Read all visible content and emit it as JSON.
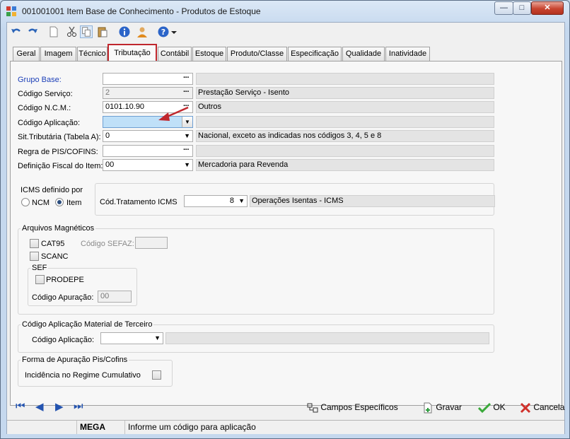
{
  "window": {
    "title": "001001001 Item Base de Conhecimento -  Produtos de Estoque",
    "minimize": "—",
    "maximize": "□",
    "close": "✕"
  },
  "toolbar": {
    "icons": [
      "undo-icon",
      "redo-icon",
      "new-document-icon",
      "cut-icon",
      "copy-icon",
      "paste-icon",
      "info-icon",
      "user-icon",
      "help-icon",
      "dropdown-icon"
    ]
  },
  "tabs": [
    "Geral",
    "Imagem",
    "Técnico",
    "Tributação",
    "Contábil",
    "Estoque",
    "Produto/Classe",
    "Especificação",
    "Qualidade",
    "Inatividade"
  ],
  "selected_tab": "Tributação",
  "fields": {
    "grupo_base": {
      "label": "Grupo Base:",
      "value": "",
      "desc": ""
    },
    "codigo_servico": {
      "label": "Código Serviço:",
      "value": "2",
      "desc": "Prestação Serviço  - Isento"
    },
    "codigo_ncm": {
      "label": "Código N.C.M.:",
      "value": "0101.10.90",
      "desc": "Outros"
    },
    "codigo_aplicacao": {
      "label": "Código Aplicação:",
      "value": "",
      "desc": ""
    },
    "sit_tributaria": {
      "label": "Sit.Tributária (Tabela A):",
      "value": "0",
      "desc": "Nacional, exceto as indicadas nos códigos 3, 4, 5 e 8"
    },
    "regra_pis": {
      "label": "Regra de PIS/COFINS:",
      "value": "",
      "desc": ""
    },
    "definicao_fiscal": {
      "label": "Definição Fiscal do Item:",
      "value": "00",
      "desc": "Mercadoria para Revenda"
    }
  },
  "icms": {
    "group_label": "ICMS definido por",
    "options": [
      "NCM",
      "Item"
    ],
    "selected": "Item",
    "tratamento_label": "Cód.Tratamento ICMS",
    "tratamento_value": "8",
    "tratamento_desc": "Operações Isentas - ICMS"
  },
  "arquivos": {
    "legend": "Arquivos Magnéticos",
    "cat95": "CAT95",
    "sefaz_label": "Código SEFAZ:",
    "sefaz_value": "",
    "scanc": "SCANC",
    "sef_legend": "SEF",
    "prodepe": "PRODEPE",
    "apuracao_label": "Código Apuração:",
    "apuracao_value": "00"
  },
  "terceiro": {
    "legend": "Código Aplicação Material de Terceiro",
    "label": "Código Aplicação:",
    "value": "",
    "desc": ""
  },
  "pis_cofins": {
    "legend": "Forma de Apuração Pis/Cofins",
    "label": "Incidência no Regime Cumulativo"
  },
  "nav": {
    "first": "⏮",
    "prev": "◀",
    "next": "▶",
    "last": "⏭"
  },
  "actions": {
    "campos": "Campos Específicos",
    "gravar": "Gravar",
    "ok": "OK",
    "cancela": "Cancela"
  },
  "status": {
    "module": "MEGA",
    "message": "Informe um código para aplicação"
  },
  "colors": {
    "accent_red": "#c0272d",
    "focus_blue": "#bfe0f8",
    "label_blue": "#1c3fb8"
  }
}
